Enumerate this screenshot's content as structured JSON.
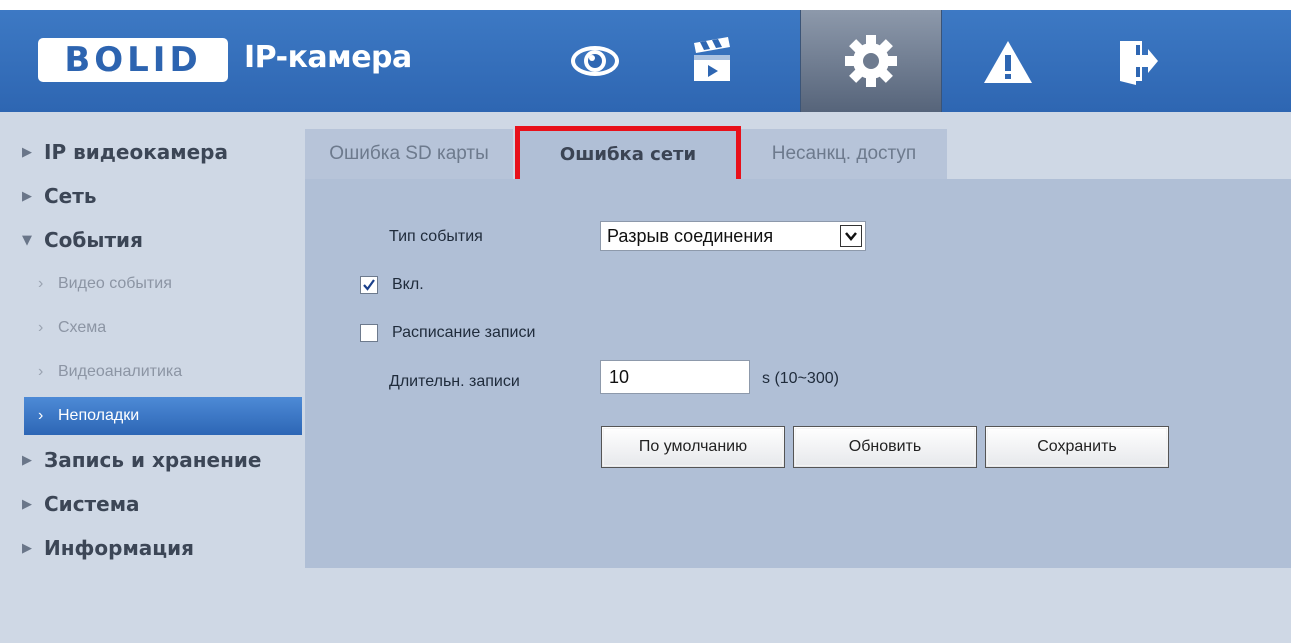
{
  "header": {
    "logo_text": "BOLID",
    "title": "IP-камера",
    "nav": [
      {
        "name": "live-view",
        "icon": "eye-icon"
      },
      {
        "name": "playback",
        "icon": "clapperboard-icon"
      },
      {
        "name": "setup",
        "icon": "gear-icon",
        "active": true
      },
      {
        "name": "alarm",
        "icon": "warning-icon"
      },
      {
        "name": "logout",
        "icon": "logout-icon"
      }
    ],
    "colors": {
      "bar": "#2e66b2",
      "active": "#56647a"
    }
  },
  "sidebar": {
    "items": [
      {
        "label": "IP видеокамера",
        "expanded": false
      },
      {
        "label": "Сеть",
        "expanded": false
      },
      {
        "label": "События",
        "expanded": true
      },
      {
        "label": "Запись и хранение",
        "expanded": false
      },
      {
        "label": "Система",
        "expanded": false
      },
      {
        "label": "Информация",
        "expanded": false
      }
    ],
    "sub_items": [
      {
        "label": "Видео события"
      },
      {
        "label": "Схема"
      },
      {
        "label": "Видеоаналитика"
      },
      {
        "label": "Неполадки",
        "active": true
      }
    ]
  },
  "tabs": [
    {
      "label": "Ошибка SD карты"
    },
    {
      "label": "Ошибка сети",
      "active": true
    },
    {
      "label": "Несанкц. доступ"
    }
  ],
  "form": {
    "event_type_label": "Тип события",
    "event_type_value": "Разрыв соединения",
    "enable_label": "Вкл.",
    "enable_checked": true,
    "record_schedule_label": "Расписание записи",
    "record_schedule_checked": false,
    "duration_label": "Длительн. записи",
    "duration_value": "10",
    "duration_hint": "s (10~300)"
  },
  "buttons": {
    "default": "По умолчанию",
    "refresh": "Обновить",
    "save": "Сохранить"
  },
  "highlight_color": "#e8101a"
}
